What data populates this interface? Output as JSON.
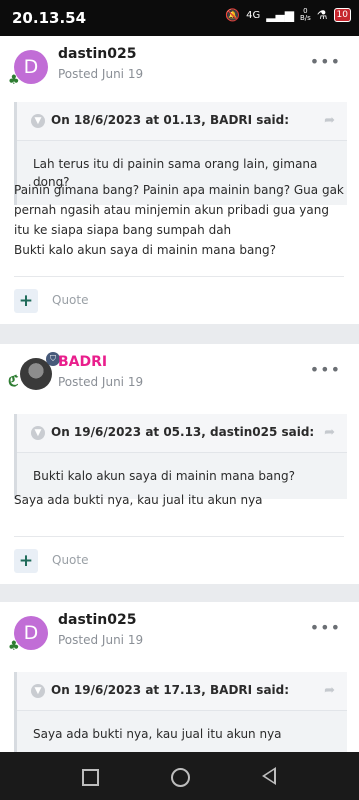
{
  "status_bar": {
    "time": "20.13.54",
    "signal": "4G",
    "net_speed_top": "0",
    "net_speed_bottom": "B/s",
    "battery": "10"
  },
  "posts": [
    {
      "author": "dastin025",
      "avatar_letter": "D",
      "date": "Posted Juni 19",
      "quote": {
        "author_line": "On 18/6/2023 at 01.13, BADRI said:",
        "body": "Lah terus itu di painin sama orang lain, gimana dong?"
      },
      "text_1": "Painin gimana bang? Painin apa mainin bang? Gua gak pernah ngasih atau minjemin akun pribadi gua yang itu ke siapa siapa bang sumpah dah",
      "text_2": "Bukti kalo akun saya di mainin mana bang?",
      "quote_label": "Quote"
    },
    {
      "author": "BADRI",
      "date": "Posted Juni 19",
      "quote": {
        "author_line": "On 19/6/2023 at 05.13, dastin025 said:",
        "body": "Bukti kalo akun saya di mainin mana bang?"
      },
      "text_1": "Saya ada bukti nya, kau jual itu akun nya",
      "quote_label": "Quote"
    },
    {
      "author": "dastin025",
      "avatar_letter": "D",
      "date": "Posted Juni 19",
      "quote": {
        "author_line": "On 19/6/2023 at 17.13, BADRI said:",
        "body": "Saya ada bukti nya, kau jual itu akun nya"
      }
    }
  ],
  "icons": {
    "more": "more-horizontal-icon",
    "tree": "tree-badge-icon",
    "chevron": "chevron-down-icon",
    "reply_arrow": "share-arrow-icon",
    "plus": "plus-icon"
  },
  "colors": {
    "accent_pink": "#e91e8c",
    "avatar_purple": "#c16dd6",
    "tree_green": "#2e7d32"
  }
}
